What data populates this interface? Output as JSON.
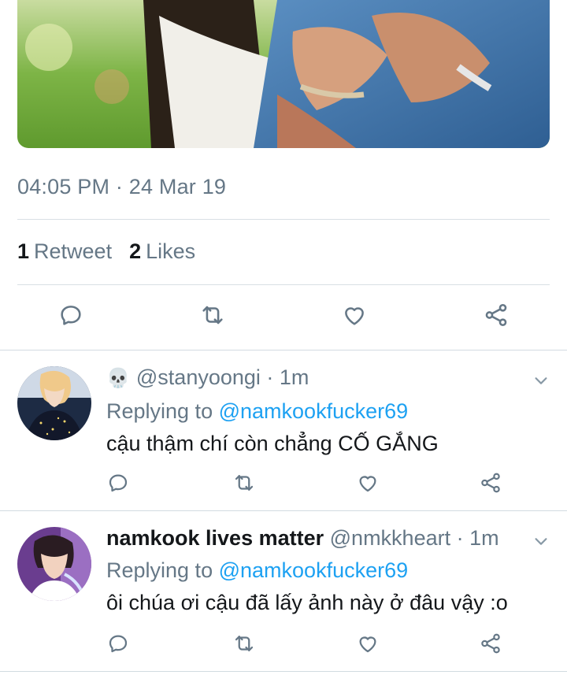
{
  "tweet": {
    "timestamp": "04:05 PM · 24 Mar 19",
    "retweets_count": "1",
    "retweets_label": "Retweet",
    "likes_count": "2",
    "likes_label": "Likes"
  },
  "colors": {
    "accent": "#1da1f2",
    "secondary_text": "#657786",
    "primary_text": "#14171a",
    "divider": "#d8dfe4"
  },
  "icons": {
    "reply": "reply-icon",
    "retweet": "retweet-icon",
    "like": "heart-icon",
    "share": "share-icon",
    "more": "chevron-down-icon"
  },
  "replies": [
    {
      "emoji": "💀",
      "display_name": "",
      "handle": "@stanyoongi",
      "time": "· 1m",
      "replying_prefix": "Replying to",
      "replying_to": "@namkookfucker69",
      "text": "cậu thậm chí còn chẳng CỐ GẮNG"
    },
    {
      "emoji": "",
      "display_name": "namkook lives matter",
      "handle": "@nmkkheart",
      "time": "· 1m",
      "replying_prefix": "Replying to",
      "replying_to": "@namkookfucker69",
      "text": "ôi chúa ơi cậu đã lấy ảnh này ở đâu vậy :o"
    }
  ]
}
